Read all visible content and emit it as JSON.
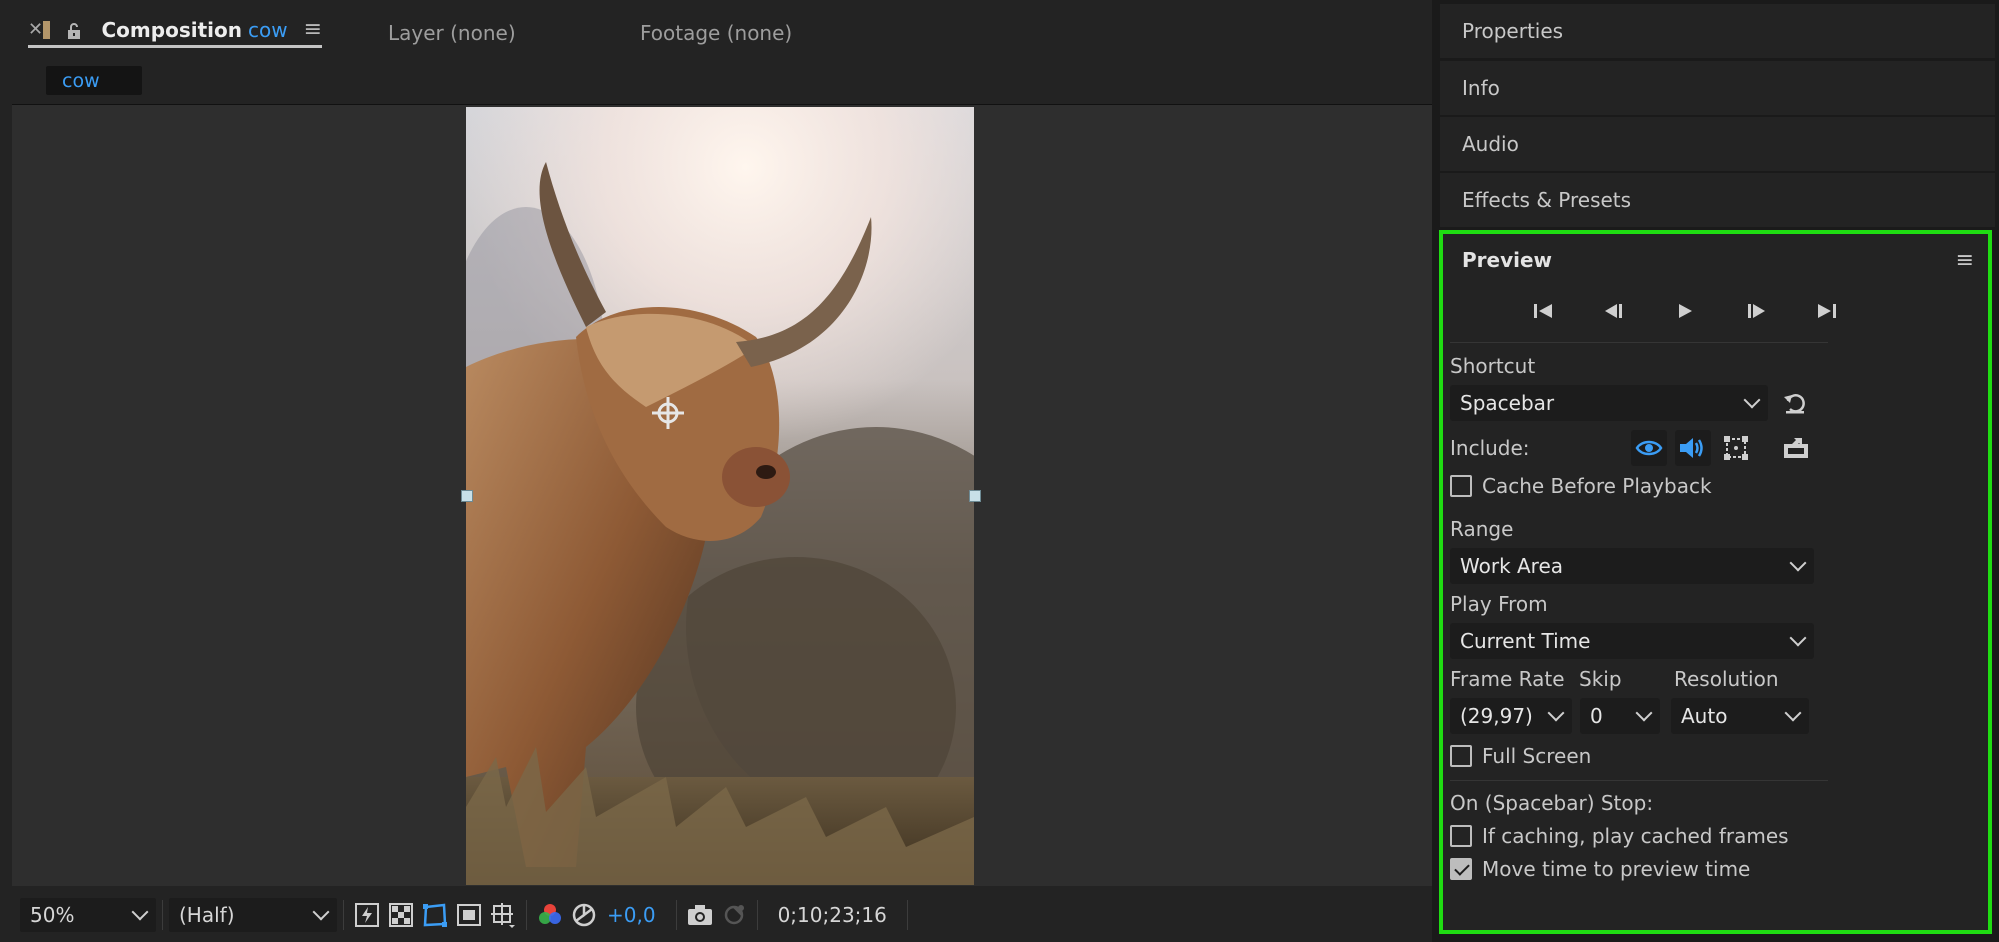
{
  "composition_panel": {
    "tabs": {
      "composition": {
        "label": "Composition",
        "name": "cow"
      },
      "layer": {
        "label": "Layer (none)"
      },
      "footage": {
        "label": "Footage (none)"
      }
    },
    "flowchart_chip": "cow"
  },
  "viewer_bar": {
    "zoom": "50%",
    "resolution": "(Half)",
    "exposure": "+0,0",
    "timecode": "0;10;23;16"
  },
  "right_panels": {
    "properties": "Properties",
    "info": "Info",
    "audio": "Audio",
    "effects": "Effects & Presets"
  },
  "preview": {
    "title": "Preview",
    "shortcut_label": "Shortcut",
    "shortcut_value": "Spacebar",
    "include_label": "Include:",
    "cache_before_playback": {
      "label": "Cache Before Playback",
      "checked": false
    },
    "range_label": "Range",
    "range_value": "Work Area",
    "play_from_label": "Play From",
    "play_from_value": "Current Time",
    "frame_rate_label": "Frame Rate",
    "frame_rate_value": "(29,97)",
    "skip_label": "Skip",
    "skip_value": "0",
    "resolution_label": "Resolution",
    "resolution_value": "Auto",
    "full_screen": {
      "label": "Full Screen",
      "checked": false
    },
    "on_stop_label": "On (Spacebar) Stop:",
    "if_caching": {
      "label": "If caching, play cached frames",
      "checked": false
    },
    "move_time": {
      "label": "Move time to preview time",
      "checked": true
    }
  },
  "colors": {
    "accent_blue": "#3b9df5",
    "highlight_green": "#1fdc12",
    "panel_bg": "#232323"
  },
  "icons": [
    "close-icon",
    "lock-icon",
    "panel-menu-icon",
    "first-frame-icon",
    "previous-frame-icon",
    "play-icon",
    "next-frame-icon",
    "last-frame-icon",
    "reset-icon",
    "eye-icon",
    "speaker-icon",
    "overlays-icon",
    "external-monitor-icon",
    "fast-preview-icon",
    "transparency-grid-icon",
    "mask-visibility-icon",
    "region-of-interest-icon",
    "grid-guides-icon",
    "color-channels-icon",
    "exposure-reset-icon",
    "snapshot-icon",
    "show-snapshot-icon"
  ]
}
